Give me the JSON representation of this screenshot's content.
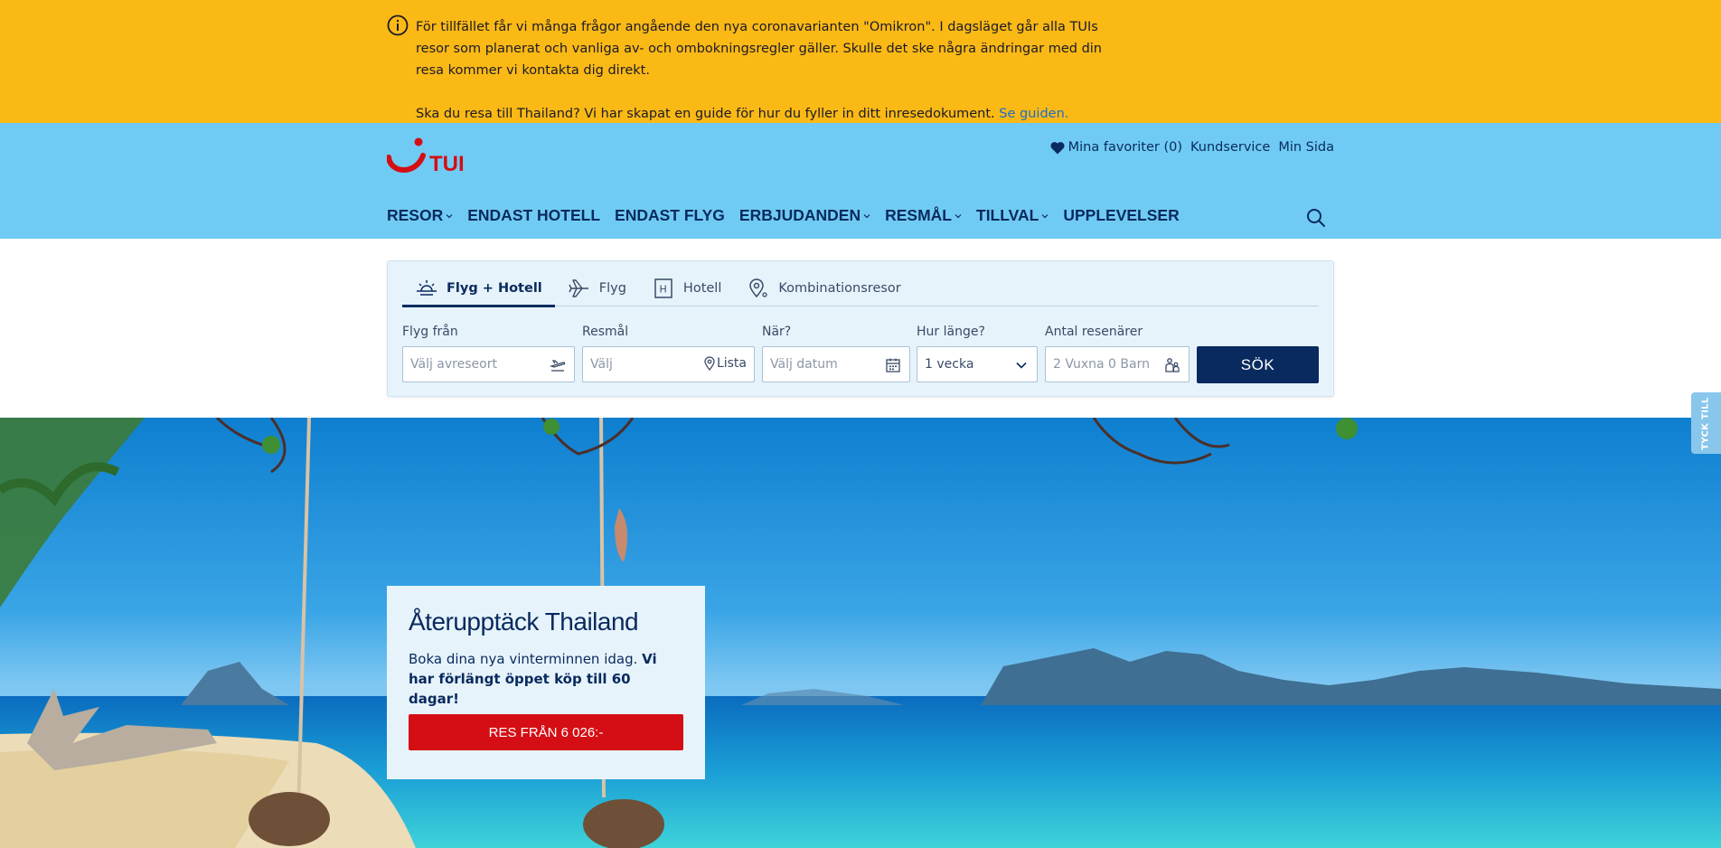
{
  "notice": {
    "line1": "För tillfället får vi många frågor angående den nya coronavarianten \"Omikron\". I dagsläget går alla TUIs resor som planerat och vanliga av- och ombokningsregler gäller. Skulle det ske några ändringar med din resa kommer vi kontakta dig direkt.",
    "line2": "Ska du resa till Thailand? Vi har skapat en guide för hur du fyller in ditt inresedokument.",
    "link": "Se guiden."
  },
  "header": {
    "logo_text": "TUI",
    "favorites": "Mina favoriter (0)",
    "customer_service": "Kundservice",
    "my_page": "Min Sida",
    "nav": [
      {
        "label": "RESOR"
      },
      {
        "label": "ENDAST HOTELL"
      },
      {
        "label": "ENDAST FLYG"
      },
      {
        "label": "ERBJUDANDEN"
      },
      {
        "label": "RESMÅL"
      },
      {
        "label": "TILLVAL"
      },
      {
        "label": "UPPLEVELSER"
      }
    ]
  },
  "search": {
    "tabs": [
      {
        "label": "Flyg + Hotell",
        "icon": "sun-icon"
      },
      {
        "label": "Flyg",
        "icon": "plane-icon"
      },
      {
        "label": "Hotell",
        "icon": "hotel-icon"
      },
      {
        "label": "Kombinationsresor",
        "icon": "map-pin-icon"
      }
    ],
    "from_label": "Flyg från",
    "from_placeholder": "Välj avreseort",
    "dest_label": "Resmål",
    "dest_placeholder": "Välj",
    "dest_list": "Lista",
    "when_label": "När?",
    "when_placeholder": "Välj datum",
    "length_label": "Hur länge?",
    "length_value": "1 vecka",
    "pax_label": "Antal resenärer",
    "pax_value": "2 Vuxna 0 Barn",
    "submit": "SÖK"
  },
  "hero": {
    "title": "Återupptäck Thailand",
    "text": "Boka dina nya vinterminnen idag.",
    "text_bold": "Vi har förlängt öppet köp till 60 dagar!",
    "cta": "RES FRÅN 6 026:-"
  },
  "feedback": "TYCK TILL",
  "colors": {
    "banner": "#fbb915",
    "header": "#70cbf4",
    "navy": "#092a5e",
    "cta_red": "#d40e14"
  }
}
